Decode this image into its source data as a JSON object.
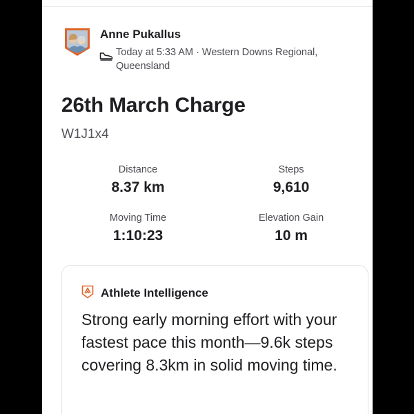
{
  "athlete": {
    "name": "Anne Pukallus",
    "meta": "Today at 5:33 AM · Western Downs Regional, Queensland"
  },
  "activity": {
    "title": "26th March Charge",
    "description": "W1J1x4"
  },
  "stats": [
    {
      "label": "Distance",
      "value": "8.37 km"
    },
    {
      "label": "Steps",
      "value": "9,610"
    },
    {
      "label": "Moving Time",
      "value": "1:10:23"
    },
    {
      "label": "Elevation Gain",
      "value": "10 m"
    }
  ],
  "athlete_intelligence": {
    "title": "Athlete Intelligence",
    "summary": "Strong early morning effort with your fastest pace this month—9.6k steps covering 8.3km in solid moving time."
  },
  "icons": {
    "activity_type": "shoe-icon",
    "intelligence": "athlete-intelligence-icon"
  },
  "colors": {
    "brand_orange": "#e0662b",
    "text_primary": "#1f1f23",
    "text_secondary": "#4b4b52"
  }
}
